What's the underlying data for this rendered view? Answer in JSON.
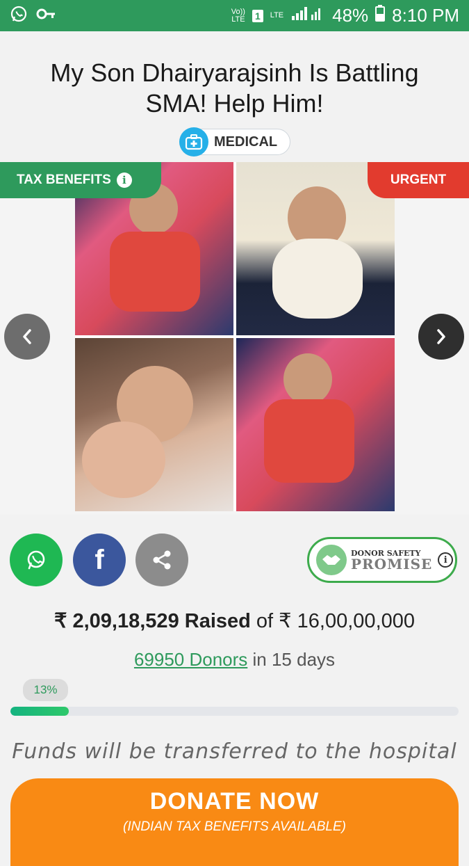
{
  "status_bar": {
    "volte_top": "Vo))",
    "volte_bottom": "LTE",
    "sim_slot": "1",
    "network": "LTE",
    "battery": "48%",
    "time": "8:10 PM"
  },
  "campaign": {
    "title_line1": "My Son Dhairyarajsinh Is Battling",
    "title_line2": "SMA! Help Him!",
    "category": "MEDICAL"
  },
  "gallery": {
    "tax_tag": "TAX BENEFITS",
    "info_glyph": "i",
    "urgent_tag": "URGENT",
    "prev_icon": "chevron-left-icon",
    "next_icon": "chevron-right-icon"
  },
  "share": {
    "facebook_glyph": "f",
    "promise_top": "DONOR SAFETY",
    "promise_bottom": "PROMISE",
    "promise_info": "i"
  },
  "funding": {
    "raised_amount": "₹ 2,09,18,529 Raised",
    "of_text": "of",
    "goal_amount": "₹ 16,00,00,000",
    "donors_link": "69950 Donors",
    "duration": "in 15 days",
    "progress_label": "13%",
    "progress_value": 13
  },
  "note": "Funds will be transferred to the hospital",
  "donate": {
    "label": "DONATE NOW",
    "sub_label": "(INDIAN TAX BENEFITS AVAILABLE)"
  },
  "colors": {
    "brand_green": "#2e9a5c",
    "urgent_red": "#e23b2e",
    "donate_orange": "#f98a14",
    "whatsapp": "#1fb853",
    "facebook": "#3b579d"
  }
}
